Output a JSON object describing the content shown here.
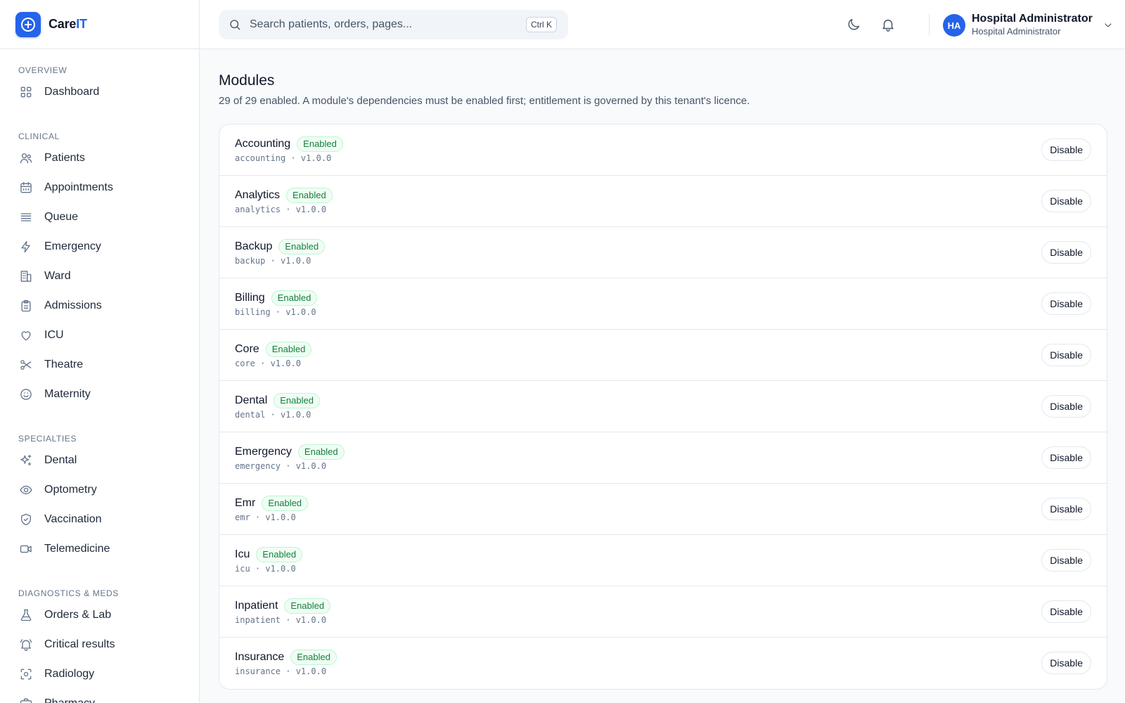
{
  "brand": {
    "name_prefix": "Care",
    "name_accent": "IT"
  },
  "search": {
    "placeholder": "Search patients, orders, pages...",
    "shortcut": "Ctrl K"
  },
  "user": {
    "initials": "HA",
    "name": "Hospital Administrator",
    "role": "Hospital Administrator"
  },
  "sidebar": {
    "sections": [
      {
        "title": "OVERVIEW",
        "items": [
          {
            "label": "Dashboard",
            "icon": "grid-icon"
          }
        ]
      },
      {
        "title": "CLINICAL",
        "items": [
          {
            "label": "Patients",
            "icon": "users-icon"
          },
          {
            "label": "Appointments",
            "icon": "calendar-icon"
          },
          {
            "label": "Queue",
            "icon": "list-icon"
          },
          {
            "label": "Emergency",
            "icon": "bolt-icon"
          },
          {
            "label": "Ward",
            "icon": "building-icon"
          },
          {
            "label": "Admissions",
            "icon": "clipboard-icon"
          },
          {
            "label": "ICU",
            "icon": "heart-icon"
          },
          {
            "label": "Theatre",
            "icon": "scissors-icon"
          },
          {
            "label": "Maternity",
            "icon": "smile-icon"
          }
        ]
      },
      {
        "title": "SPECIALTIES",
        "items": [
          {
            "label": "Dental",
            "icon": "sparkles-icon"
          },
          {
            "label": "Optometry",
            "icon": "eye-icon"
          },
          {
            "label": "Vaccination",
            "icon": "shield-check-icon"
          },
          {
            "label": "Telemedicine",
            "icon": "video-icon"
          }
        ]
      },
      {
        "title": "DIAGNOSTICS & MEDS",
        "items": [
          {
            "label": "Orders & Lab",
            "icon": "flask-icon"
          },
          {
            "label": "Critical results",
            "icon": "bell-ring-icon"
          },
          {
            "label": "Radiology",
            "icon": "scan-icon"
          },
          {
            "label": "Pharmacy",
            "icon": "briefcase-icon"
          }
        ]
      }
    ]
  },
  "main": {
    "title": "Modules",
    "subtitle": "29 of 29 enabled. A module's dependencies must be enabled first; entitlement is governed by this tenant's licence.",
    "modules": [
      {
        "name": "Accounting",
        "status": "Enabled",
        "meta": "accounting · v1.0.0",
        "action": "Disable"
      },
      {
        "name": "Analytics",
        "status": "Enabled",
        "meta": "analytics · v1.0.0",
        "action": "Disable"
      },
      {
        "name": "Backup",
        "status": "Enabled",
        "meta": "backup · v1.0.0",
        "action": "Disable"
      },
      {
        "name": "Billing",
        "status": "Enabled",
        "meta": "billing · v1.0.0",
        "action": "Disable"
      },
      {
        "name": "Core",
        "status": "Enabled",
        "meta": "core · v1.0.0",
        "action": "Disable"
      },
      {
        "name": "Dental",
        "status": "Enabled",
        "meta": "dental · v1.0.0",
        "action": "Disable"
      },
      {
        "name": "Emergency",
        "status": "Enabled",
        "meta": "emergency · v1.0.0",
        "action": "Disable"
      },
      {
        "name": "Emr",
        "status": "Enabled",
        "meta": "emr · v1.0.0",
        "action": "Disable"
      },
      {
        "name": "Icu",
        "status": "Enabled",
        "meta": "icu · v1.0.0",
        "action": "Disable"
      },
      {
        "name": "Inpatient",
        "status": "Enabled",
        "meta": "inpatient · v1.0.0",
        "action": "Disable"
      },
      {
        "name": "Insurance",
        "status": "Enabled",
        "meta": "insurance · v1.0.0",
        "action": "Disable"
      }
    ]
  },
  "colors": {
    "accent": "#2563eb",
    "badge_text": "#15803d",
    "badge_bg": "#f0fdf4"
  }
}
